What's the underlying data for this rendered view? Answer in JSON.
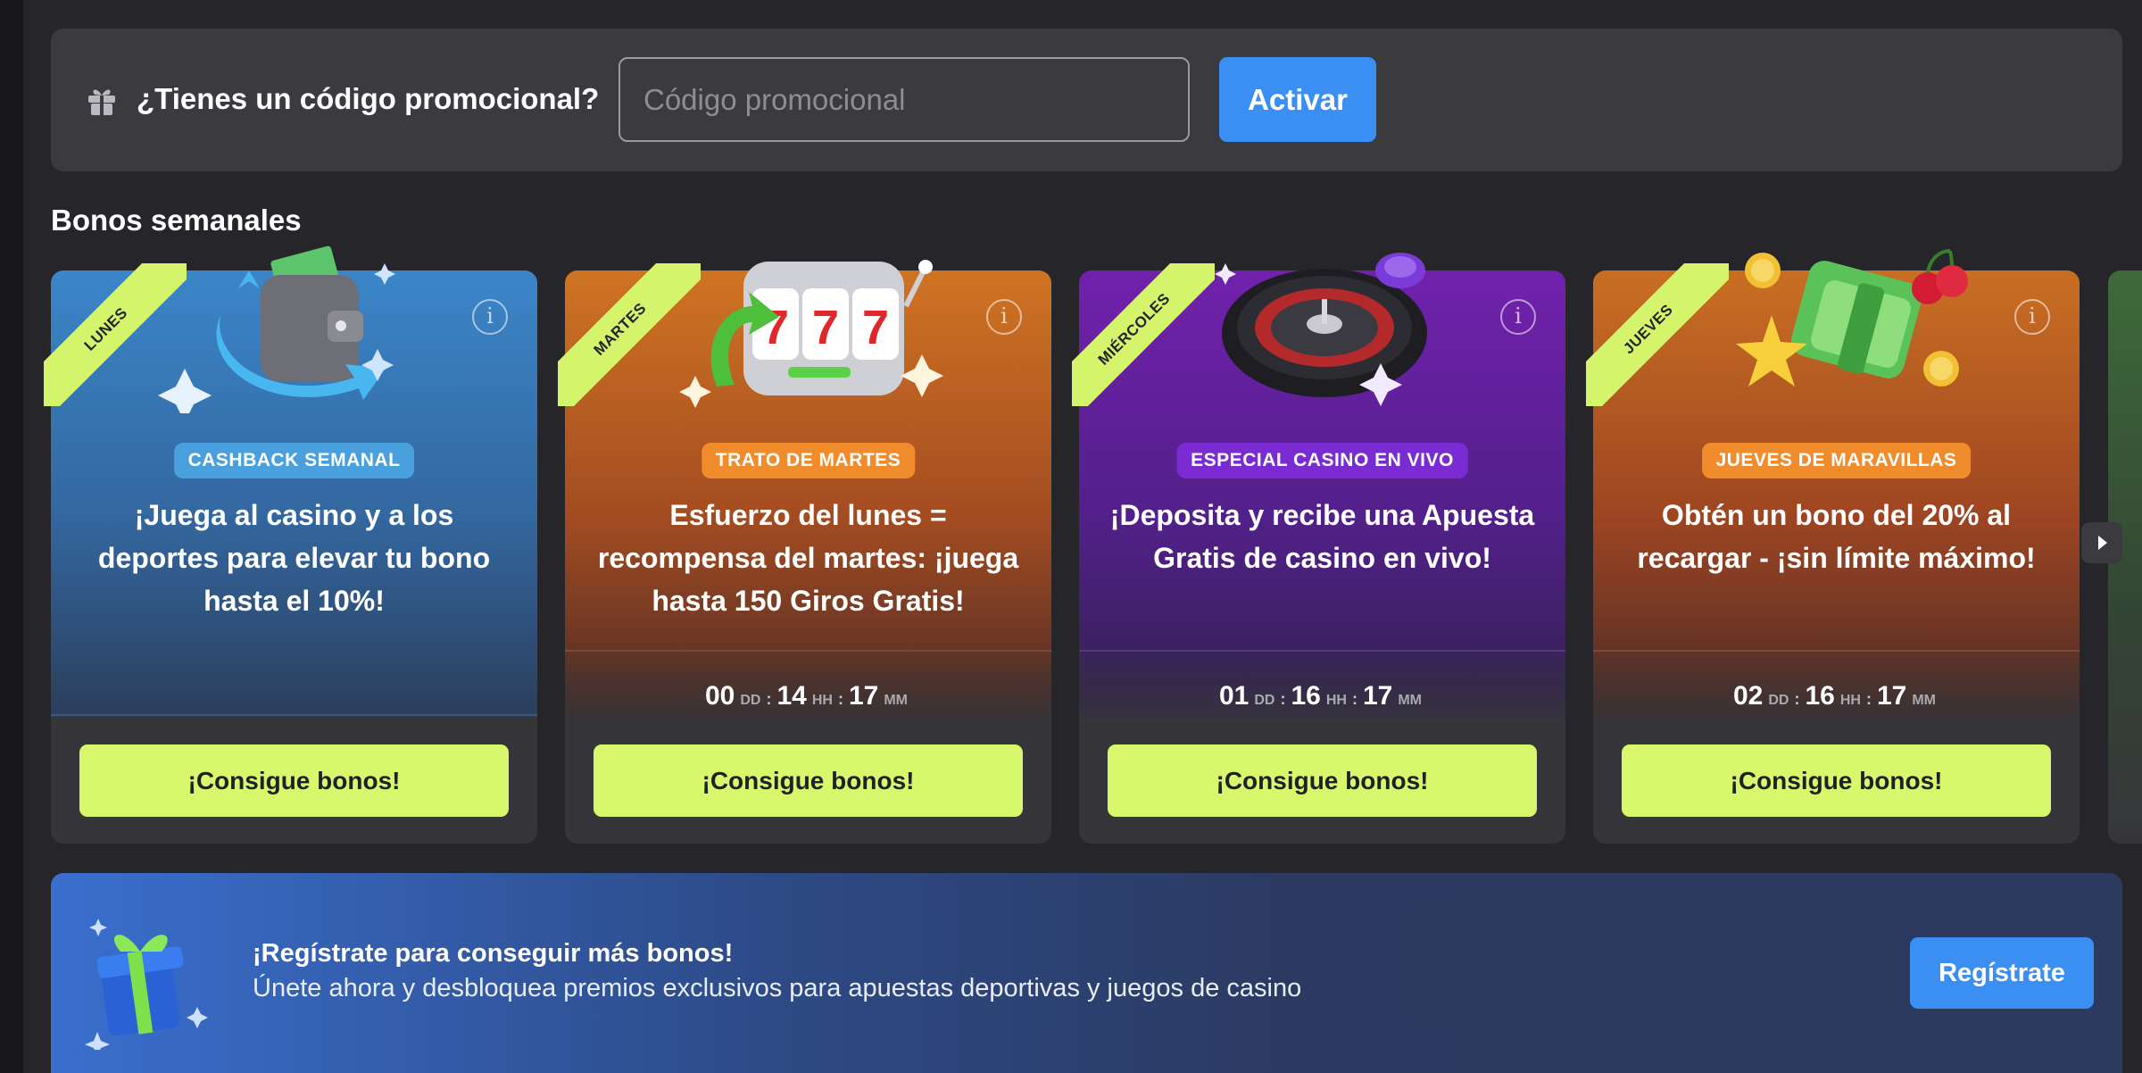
{
  "promo": {
    "question": "¿Tienes un código promocional?",
    "placeholder": "Código promocional",
    "activate_label": "Activar"
  },
  "section_title": "Bonos semanales",
  "cards": [
    {
      "ribbon": "LUNES",
      "badge": "CASHBACK SEMANAL",
      "text": "¡Juega al casino y a los deportes para elevar tu bono hasta el 10%!",
      "cta": "¡Consigue bonos!",
      "art_icon": "wallet-cashback-icon"
    },
    {
      "ribbon": "MARTES",
      "badge": "TRATO DE MARTES",
      "text": "Esfuerzo del lunes = recompensa del martes: ¡juega hasta 150 Giros Gratis!",
      "countdown": {
        "dd": "00",
        "hh": "14",
        "mm": "17"
      },
      "cta": "¡Consigue bonos!",
      "art_icon": "slot-machine-777-icon"
    },
    {
      "ribbon": "MIÉRCOLES",
      "badge": "ESPECIAL CASINO EN VIVO",
      "text": "¡Deposita y recibe una Apuesta Gratis de casino en vivo!",
      "countdown": {
        "dd": "01",
        "hh": "16",
        "mm": "17"
      },
      "cta": "¡Consigue bonos!",
      "art_icon": "roulette-wheel-icon"
    },
    {
      "ribbon": "JUEVES",
      "badge": "JUEVES DE MARAVILLAS",
      "text": "Obtén un bono del 20% al recargar - ¡sin límite máximo!",
      "countdown": {
        "dd": "02",
        "hh": "16",
        "mm": "17"
      },
      "cta": "¡Consigue bonos!",
      "art_icon": "cash-stack-cherries-icon"
    }
  ],
  "countdown_units": {
    "dd": "DD",
    "hh": "HH",
    "mm": "MM"
  },
  "register": {
    "title": "¡Regístrate para conseguir más bonos!",
    "subtitle": "Únete ahora y desbloquea premios exclusivos para apuestas deportivas y juegos de casino",
    "button": "Regístrate"
  },
  "colors": {
    "accent_blue": "#3c8ff2",
    "lime": "#d7f76c",
    "panel": "#3b3b3f",
    "background": "#26262a"
  }
}
